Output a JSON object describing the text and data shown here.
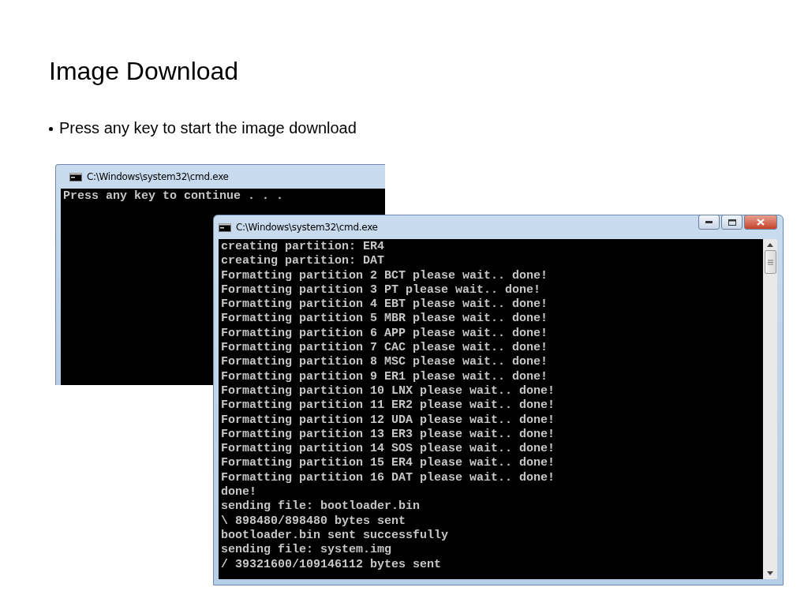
{
  "slide": {
    "title": "Image Download",
    "bullets": [
      "Press any key to start the image download"
    ]
  },
  "windows": [
    {
      "kind": "cropped",
      "title": "C:\\Windows\\system32\\cmd.exe",
      "lines": [
        "Press any key to continue . . ."
      ]
    },
    {
      "kind": "full",
      "title": "C:\\Windows\\system32\\cmd.exe",
      "lines": [
        "creating partition: ER4",
        "creating partition: DAT",
        "Formatting partition 2 BCT please wait.. done!",
        "Formatting partition 3 PT please wait.. done!",
        "Formatting partition 4 EBT please wait.. done!",
        "Formatting partition 5 MBR please wait.. done!",
        "Formatting partition 6 APP please wait.. done!",
        "Formatting partition 7 CAC please wait.. done!",
        "Formatting partition 8 MSC please wait.. done!",
        "Formatting partition 9 ER1 please wait.. done!",
        "Formatting partition 10 LNX please wait.. done!",
        "Formatting partition 11 ER2 please wait.. done!",
        "Formatting partition 12 UDA please wait.. done!",
        "Formatting partition 13 ER3 please wait.. done!",
        "Formatting partition 14 SOS please wait.. done!",
        "Formatting partition 15 ER4 please wait.. done!",
        "Formatting partition 16 DAT please wait.. done!",
        "done!",
        "sending file: bootloader.bin",
        "\\ 898480/898480 bytes sent",
        "bootloader.bin sent successfully",
        "sending file: system.img",
        "/ 39321600/109146112 bytes sent"
      ]
    }
  ]
}
